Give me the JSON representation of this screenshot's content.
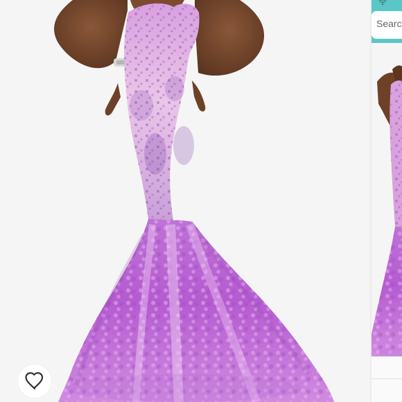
{
  "main_image": {
    "subject": "purple-mermaid-gown-photo"
  },
  "right_rail": {
    "search": {
      "placeholder": "Search"
    },
    "thumbnail": {
      "subject": "purple-mermaid-gown-thumbnail"
    }
  },
  "icons": {
    "favorite": "heart-icon",
    "top_indicator": "wifi-icon"
  },
  "colors": {
    "accent": "#59c6c7",
    "gown": "#b86bd3",
    "background": "#f5f5f5"
  }
}
